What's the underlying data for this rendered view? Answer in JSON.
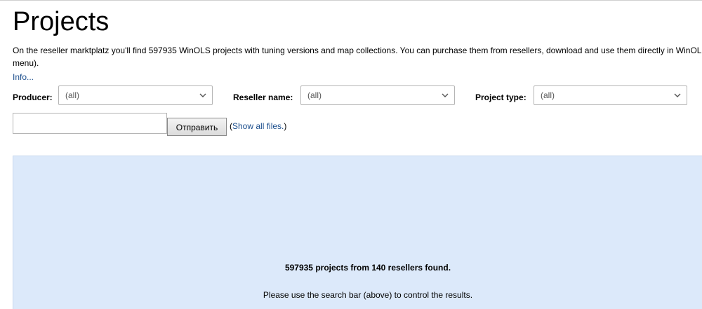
{
  "page": {
    "title": "Projects",
    "intro": "On the reseller marktplatz you'll find 597935 WinOLS projects with tuning versions and map collections. You can purchase them from resellers, download and use them directly in WinOLS (Client-menu).",
    "info_link": "Info..."
  },
  "filters": {
    "producer": {
      "label": "Producer:",
      "value": "(all)"
    },
    "reseller": {
      "label": "Reseller name:",
      "value": "(all)"
    },
    "project_type": {
      "label": "Project type:",
      "value": "(all)"
    }
  },
  "search": {
    "input_value": "",
    "submit_label": "Отправить",
    "show_all_prefix": "(",
    "show_all_label": "Show all files.",
    "show_all_suffix": ")"
  },
  "results": {
    "count_text": "597935 projects from 140 resellers found.",
    "hint_text": "Please use the search bar (above) to control the results."
  },
  "colors": {
    "link": "#1a4d8c",
    "results_background": "#dce9fa"
  }
}
